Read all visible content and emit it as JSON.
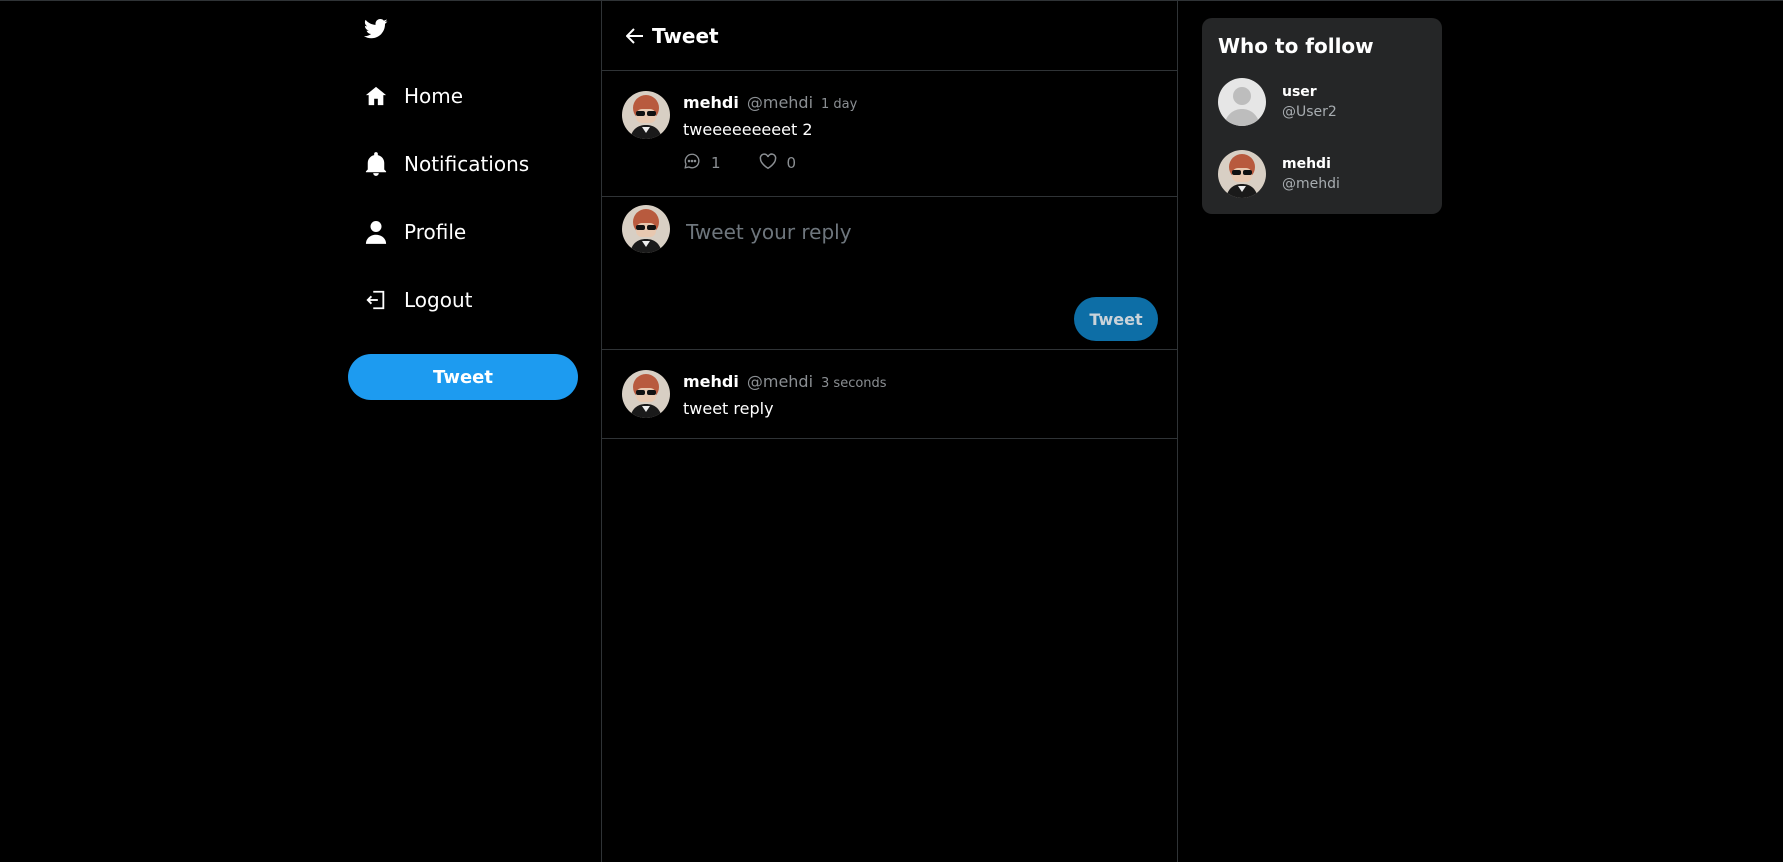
{
  "nav": {
    "logo": "twitter-bird-icon",
    "items": [
      {
        "label": "Home",
        "icon": "home-icon"
      },
      {
        "label": "Notifications",
        "icon": "bell-icon"
      },
      {
        "label": "Profile",
        "icon": "user-icon"
      },
      {
        "label": "Logout",
        "icon": "logout-icon"
      }
    ],
    "tweet_button": "Tweet"
  },
  "header": {
    "title": "Tweet",
    "back_icon": "arrow-left-icon"
  },
  "tweet": {
    "name": "mehdi",
    "handle": "@mehdi",
    "time": "1 day",
    "text": "tweeeeeeeeet 2",
    "replies": "1",
    "likes": "0"
  },
  "reply_composer": {
    "placeholder": "Tweet your reply",
    "button": "Tweet"
  },
  "replies": [
    {
      "name": "mehdi",
      "handle": "@mehdi",
      "time": "3 seconds",
      "text": "tweet reply"
    }
  ],
  "who_to_follow": {
    "title": "Who to follow",
    "users": [
      {
        "name": "user",
        "handle": "@User2",
        "avatar": "default-avatar"
      },
      {
        "name": "mehdi",
        "handle": "@mehdi",
        "avatar": "anime-avatar"
      }
    ]
  },
  "colors": {
    "accent": "#1d9bf0",
    "border": "#2f3336",
    "card": "#252627",
    "muted": "#8b8f93"
  }
}
